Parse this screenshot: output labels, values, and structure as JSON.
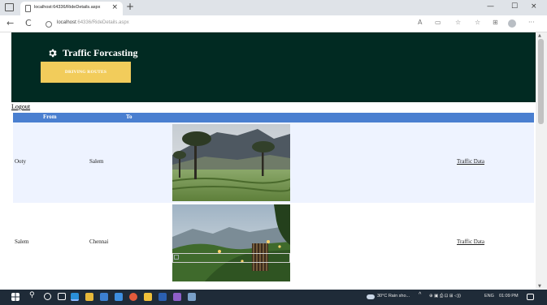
{
  "browser": {
    "tab_title": "localhost:64336/RideDetails.aspx",
    "tab_close": "×",
    "new_tab": "+",
    "url_host": "localhost",
    "url_path": ":64336/RideDetails.aspx",
    "back": "←",
    "refresh": "C",
    "read_aloud": "A",
    "minimize": "—",
    "maximize": "☐",
    "close": "×",
    "more": "···"
  },
  "header": {
    "title": "Traffic Forcasting",
    "icon": "gear-icon",
    "nav_button": "DRIVING ROUTES",
    "bg_color": "#012a22",
    "button_color": "#f2cc5b"
  },
  "logout": "Logout",
  "table": {
    "columns": [
      "From",
      "To"
    ],
    "header_color": "#4a7fd0",
    "rows": [
      {
        "from": "Ooty",
        "to": "Salem",
        "image": "tea-plantation-photo",
        "link": "Traffic Data"
      },
      {
        "from": "Salem",
        "to": "Chennai",
        "image": "hill-station-lights-photo",
        "link": "Traffic Data"
      }
    ]
  },
  "taskbar": {
    "weather": "30°C Rain sho...",
    "language": "ENG",
    "time": "01:09 PM",
    "icons": [
      "windows-icon",
      "search-icon",
      "cortana-icon",
      "task-view-icon",
      "edge-icon",
      "file-explorer-icon",
      "mail-icon",
      "store-icon",
      "chrome-icon",
      "app-icon",
      "word-icon",
      "visual-studio-icon",
      "photos-icon"
    ]
  }
}
